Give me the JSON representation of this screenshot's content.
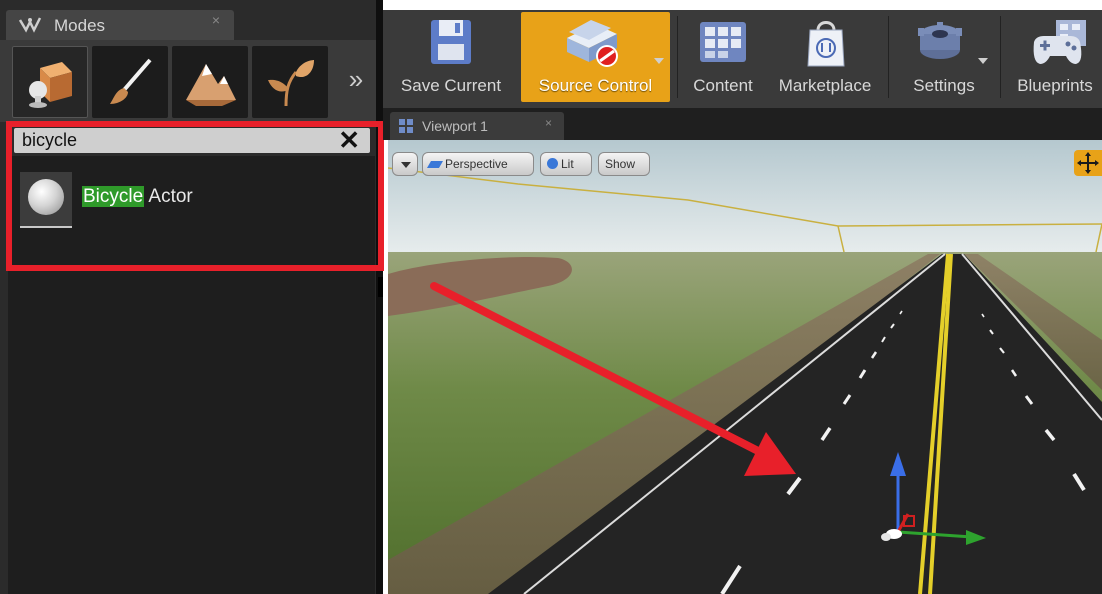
{
  "modes_panel": {
    "tab_title": "Modes",
    "tab_close": "×",
    "mode_buttons": [
      "place-mode",
      "paint-mode",
      "landscape-mode",
      "foliage-mode"
    ],
    "more_label": "»",
    "search": {
      "value": "bicycle",
      "clear_label": "✕"
    },
    "results": [
      {
        "highlight": "Bicycle",
        "rest": " Actor"
      }
    ]
  },
  "toolbar": {
    "save_label": "Save Current",
    "source_control_label": "Source Control",
    "content_label": "Content",
    "marketplace_label": "Marketplace",
    "settings_label": "Settings",
    "blueprints_label": "Blueprints"
  },
  "viewport": {
    "tab_label": "Viewport 1",
    "tab_close": "×",
    "perspective_label": "Perspective",
    "lit_label": "Lit",
    "show_label": "Show"
  },
  "annotations": {
    "highlight_color": "#e8202a",
    "arrow_color": "#e8202a"
  },
  "colors": {
    "accent": "#e8a218",
    "search_match": "#2f9a2a",
    "panel_bg": "#2b2b2b"
  }
}
